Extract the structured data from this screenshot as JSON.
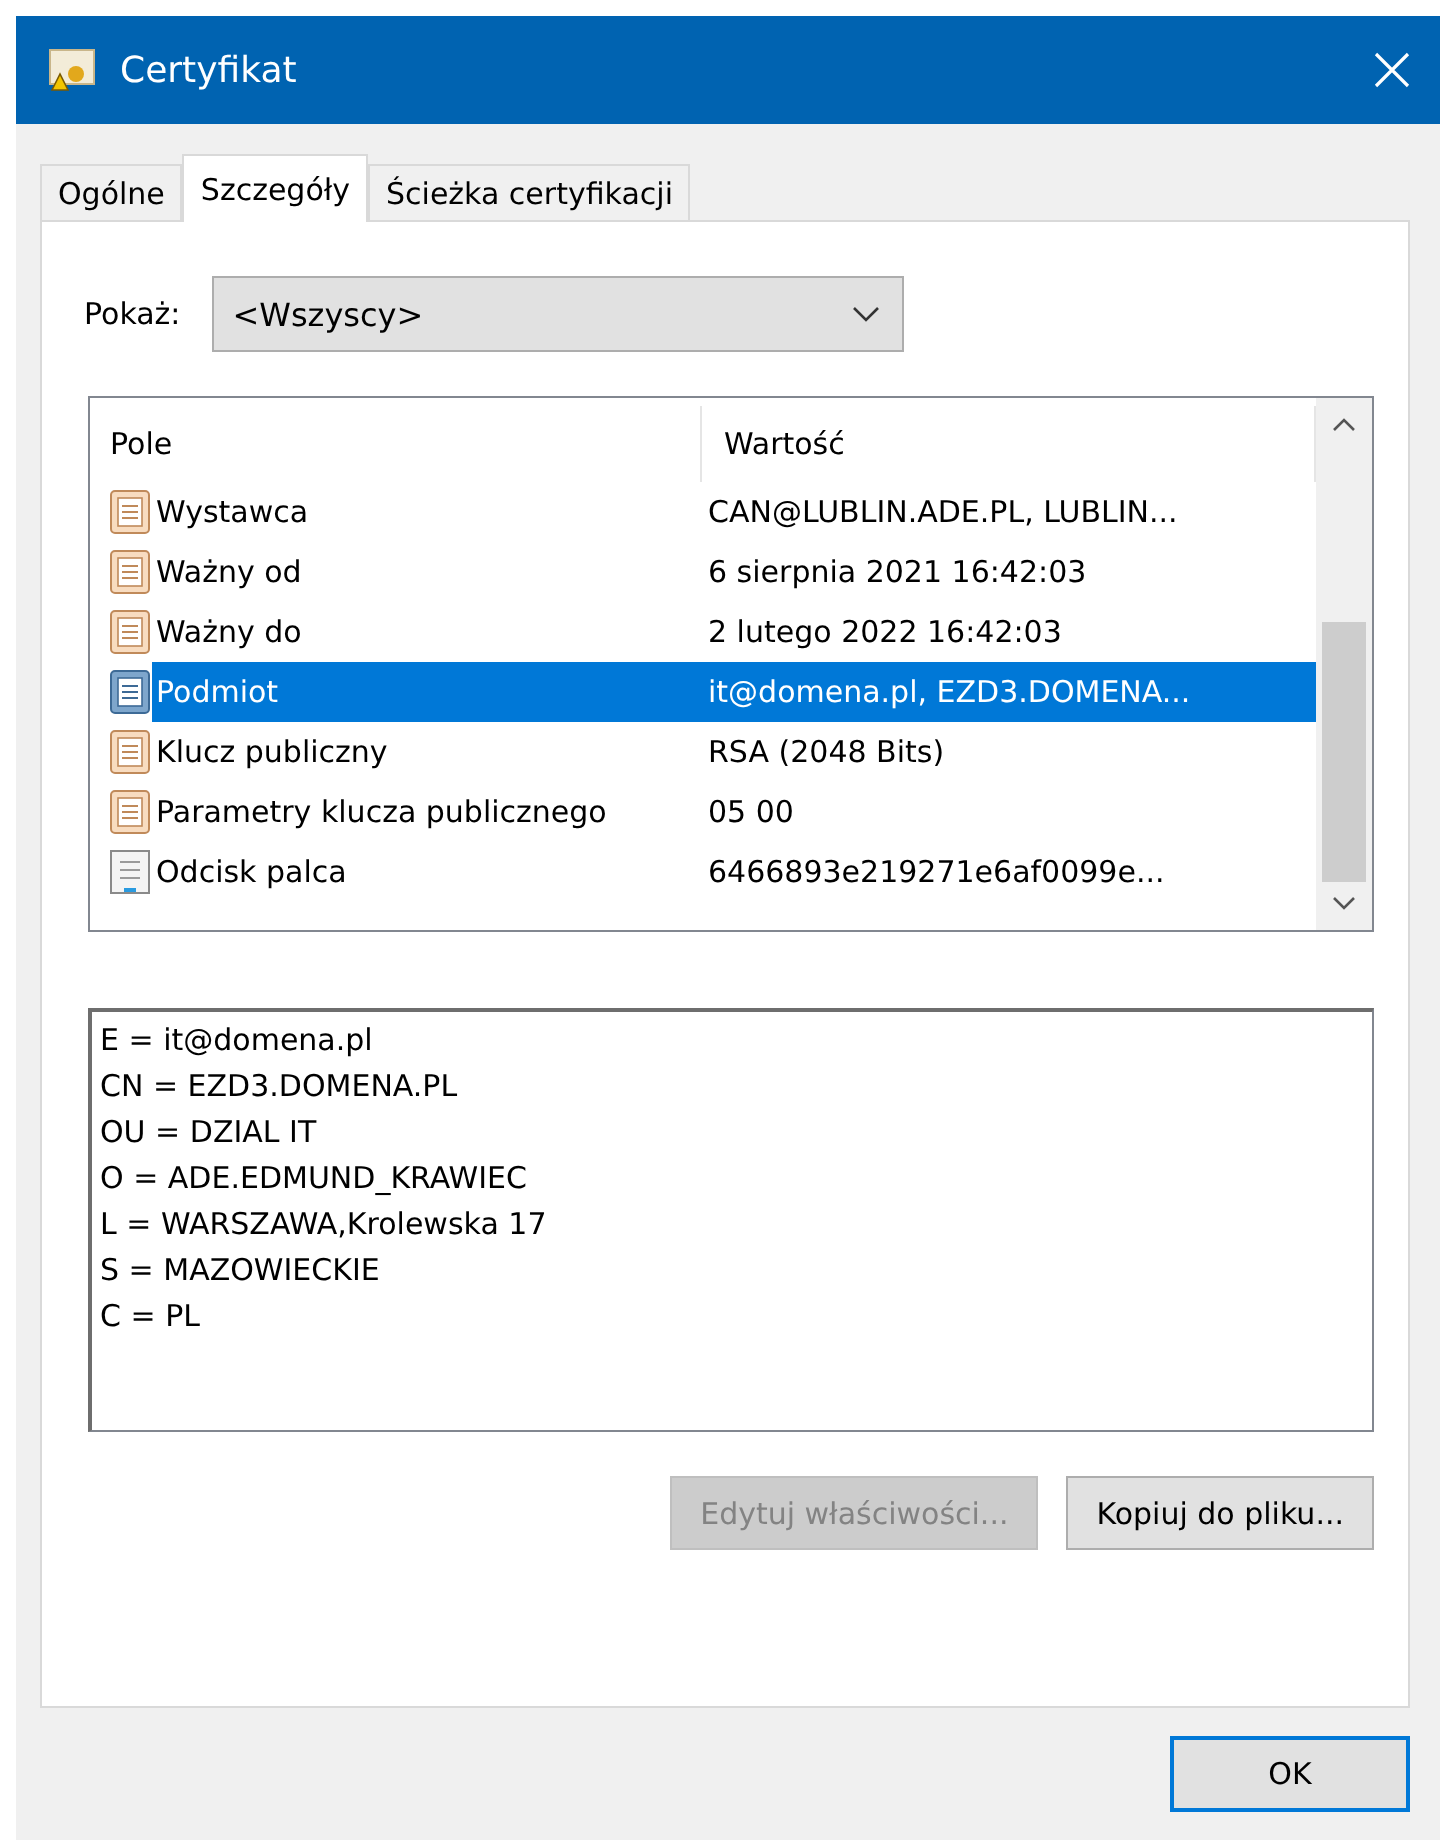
{
  "window": {
    "title": "Certyfikat"
  },
  "tabs": [
    {
      "label": "Ogólne",
      "selected": false
    },
    {
      "label": "Szczegóły",
      "selected": true
    },
    {
      "label": "Ścieżka certyfikacji",
      "selected": false
    }
  ],
  "show": {
    "label": "Pokaż:",
    "value": "<Wszyscy>"
  },
  "table": {
    "columns": [
      "Pole",
      "Wartość"
    ],
    "rows": [
      {
        "field": "Wystawca",
        "value": "CAN@LUBLIN.ADE.PL, LUBLIN...",
        "kind": "property",
        "selected": false
      },
      {
        "field": "Ważny od",
        "value": "6 sierpnia 2021 16:42:03",
        "kind": "property",
        "selected": false
      },
      {
        "field": "Ważny do",
        "value": "2 lutego 2022 16:42:03",
        "kind": "property",
        "selected": false
      },
      {
        "field": "Podmiot",
        "value": "it@domena.pl, EZD3.DOMENA...",
        "kind": "property",
        "selected": true
      },
      {
        "field": "Klucz publiczny",
        "value": "RSA (2048 Bits)",
        "kind": "property",
        "selected": false
      },
      {
        "field": "Parametry klucza publicznego",
        "value": "05 00",
        "kind": "property",
        "selected": false
      },
      {
        "field": "Odcisk palca",
        "value": "6466893e219271e6af0099e...",
        "kind": "extension",
        "selected": false
      }
    ]
  },
  "details": [
    "E = it@domena.pl",
    "CN = EZD3.DOMENA.PL",
    "OU = DZIAL IT",
    "O = ADE.EDMUND_KRAWIEC",
    "L = WARSZAWA,Krolewska 17",
    "S = MAZOWIECKIE",
    "C = PL"
  ],
  "buttons": [
    {
      "label": "Edytuj właściwości...",
      "disabled": true
    },
    {
      "label": "Kopiuj do pliku...",
      "disabled": false
    }
  ],
  "ok": "OK"
}
